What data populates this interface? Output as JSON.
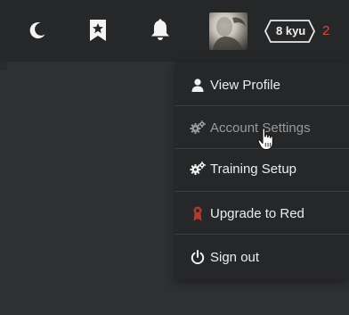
{
  "header": {
    "theme_toggle_icon": "moon-icon",
    "bookmarks_icon": "bookmark-star-icon",
    "notifications_icon": "bell-icon",
    "avatar_icon": "user-avatar",
    "rank_label": "8 kyu",
    "honor_value": "2",
    "honor_color": "#d44b3d"
  },
  "menu": {
    "items": [
      {
        "label": "View Profile",
        "icon": "user-icon"
      },
      {
        "label": "Account Settings",
        "icon": "gears-icon"
      },
      {
        "label": "Training Setup",
        "icon": "gears-icon"
      },
      {
        "label": "Upgrade to Red",
        "icon": "ribbon-icon",
        "icon_color": "#b33a2f"
      },
      {
        "label": "Sign out",
        "icon": "power-icon"
      }
    ]
  }
}
